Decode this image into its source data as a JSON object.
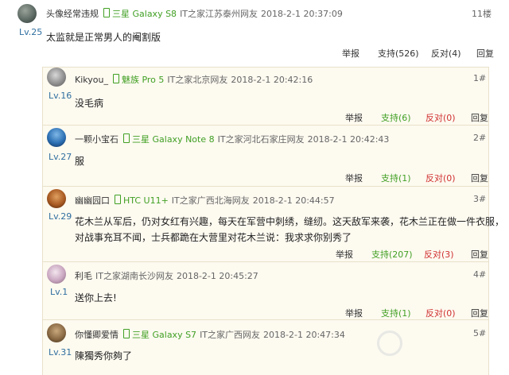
{
  "main_post": {
    "username": "头像经常违规",
    "level": "Lv.25",
    "phone": "三星 Galaxy S8",
    "source": "IT之家江苏泰州网友",
    "time": "2018-2-1 20:37:09",
    "floor": "11楼",
    "content": "太监就是正常男人的阉割版",
    "actions": {
      "report": "举报",
      "support": "支持(526)",
      "oppose": "反对(4)",
      "reply": "回复"
    }
  },
  "replies": [
    {
      "username": "Kikyou_",
      "level": "Lv.16",
      "phone": "魅族 Pro 5",
      "source": "IT之家北京网友",
      "time": "2018-2-1 20:42:16",
      "floor": "1#",
      "content": [
        "没毛病"
      ],
      "actions": {
        "report": "举报",
        "support": "支持(6)",
        "oppose": "反对(0)",
        "reply": "回复"
      }
    },
    {
      "username": "一颗小宝石",
      "level": "Lv.27",
      "phone": "三星 Galaxy Note 8",
      "source": "IT之家河北石家庄网友",
      "time": "2018-2-1 20:42:43",
      "floor": "2#",
      "content": [
        "服"
      ],
      "actions": {
        "report": "举报",
        "support": "支持(1)",
        "oppose": "反对(0)",
        "reply": "回复"
      }
    },
    {
      "username": "幽幽园口",
      "level": "Lv.29",
      "phone": "HTC U11+",
      "source": "IT之家广西北海网友",
      "time": "2018-2-1 20:44:57",
      "floor": "3#",
      "content": [
        "花木兰从军后，仍对女红有兴趣，每天在军营中刺绣，缝纫。这天敌军来袭，花木兰正在做一件衣服，",
        "对战事充耳不闻，士兵都跪在大营里对花木兰说：我求求你别秀了"
      ],
      "actions": {
        "report": "举报",
        "support": "支持(207)",
        "oppose": "反对(3)",
        "reply": "回复"
      }
    },
    {
      "username": "利毛",
      "level": "Lv.1",
      "phone": "",
      "source": "IT之家湖南长沙网友",
      "time": "2018-2-1 20:45:27",
      "floor": "4#",
      "content": [
        "送你上去!"
      ],
      "actions": {
        "report": "举报",
        "support": "支持(1)",
        "oppose": "反对(0)",
        "reply": "回复"
      }
    },
    {
      "username": "你懂卿爱情",
      "level": "Lv.31",
      "phone": "三星 Galaxy S7",
      "source": "IT之家广西网友",
      "time": "2018-2-1 20:47:34",
      "floor": "5#",
      "content": [
        "陳獨秀你夠了"
      ],
      "actions": {
        "report": "",
        "support": "",
        "oppose": "",
        "reply": ""
      }
    }
  ],
  "colors": {
    "phone": "#41a024",
    "support": "#41a024",
    "oppose": "#d03030",
    "level": "#2f6f9f",
    "reply_bg": "#fdfaf0"
  }
}
